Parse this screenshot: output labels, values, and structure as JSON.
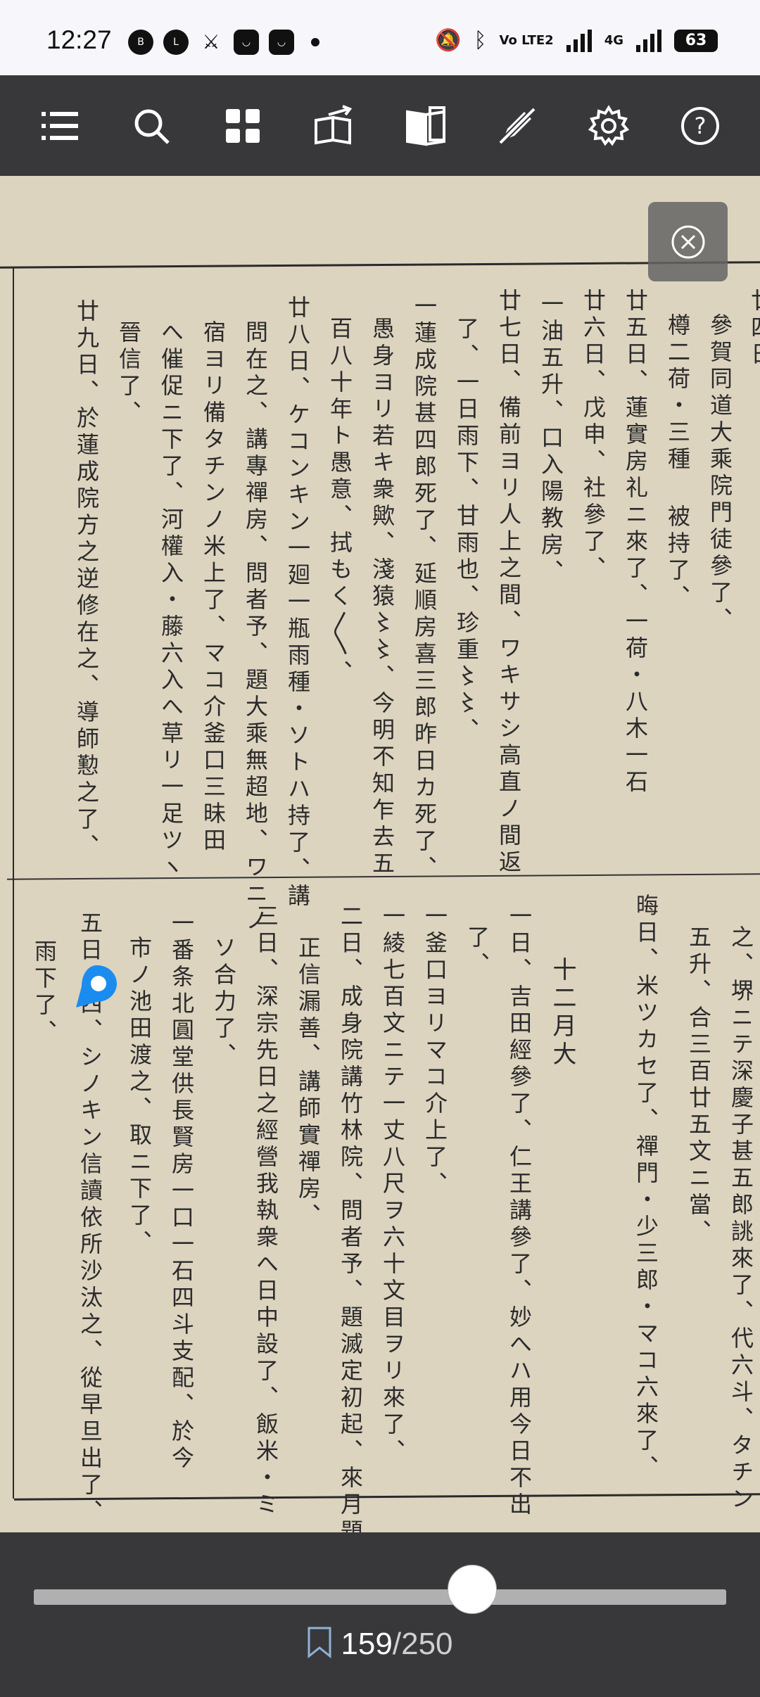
{
  "status_bar": {
    "time": "12:27",
    "left_icons": [
      "link-icon",
      "line-icon",
      "cross-icon",
      "bag-icon",
      "bag-icon"
    ],
    "network_label_1": "Vo LTE2",
    "network_label_2": "4G",
    "battery": "63"
  },
  "toolbar": {
    "icons": [
      "menu-icon",
      "search-icon",
      "grid-icon",
      "share-book-icon",
      "book-open-icon",
      "no-edit-icon",
      "gear-icon",
      "help-icon"
    ]
  },
  "page": {
    "columns_top": [
      "廿四日。",
      "參賀同道大乘院門徒參了、",
      "樽二荷・三種 被持了、",
      "廿五日、蓮實房礼ニ來了、一荷・八木一石",
      "廿六日、戊申、社參了、",
      "一油五升、口入陽教房、",
      "廿七日、備前ヨリ人上之間、ワキサシ高直ノ間返",
      "了、一日雨下、甘雨也、珍重〻〻、",
      "一蓮成院甚四郎死了、延順房喜三郎昨日カ死了、",
      "愚身ヨリ若キ衆歟、淺猿〻〻、今明不知乍去五",
      "百八十年ト愚意、拭もく〳〵、",
      "廿八日、ケコンキン一廻一瓶雨種・ソトハ持了、講",
      "問在之、講專禪房、問者予、題大乘無超地、ワニノ",
      "宿ヨリ備タチンノ米上了、マコ介釜口三昧田",
      "へ催促ニ下了、河權入・藤六入へ草リ一足ツヽ",
      "晉信了、",
      "廿九日、於蓮成院方之逆修在之、導師懃之了、"
    ],
    "columns_bottom": [
      "之、堺ニテ深慶子甚五郎誂來了、代六斗、タチン",
      "五升、合三百廿五文ニ當、",
      "晦日、米ツカセ了、禪門・少三郎・マコ六來了、",
      "十二月大",
      "一日、吉田經參了、仁王講參了、妙へハ用今日不出",
      "了、",
      "一釜口ヨリマコ介上了、",
      "一綾七百文ニテ一丈八尺ヲ六十文目ヲリ來了、",
      "二日、成身院講竹林院、問者予、題滅定初起、來月題",
      "正信漏善、講師實禪房、",
      "三日、深宗先日之經營我執衆へ日中設了、飯米・ミ",
      "ソ合力了、",
      "一番条北圓堂供長賢房一口一石四斗支配、於今",
      "市ノ池田渡之、取ニ下了、",
      "五日、西、シノキン信讀依所沙汰之、從早旦出了、",
      "雨下了、"
    ]
  },
  "overlay": {
    "close_icon": "close-circle-icon"
  },
  "bottom_bar": {
    "progress": 0.632,
    "current_page": "159",
    "separator": "/",
    "total_pages": "250",
    "bookmark_icon": "bookmark-icon"
  }
}
